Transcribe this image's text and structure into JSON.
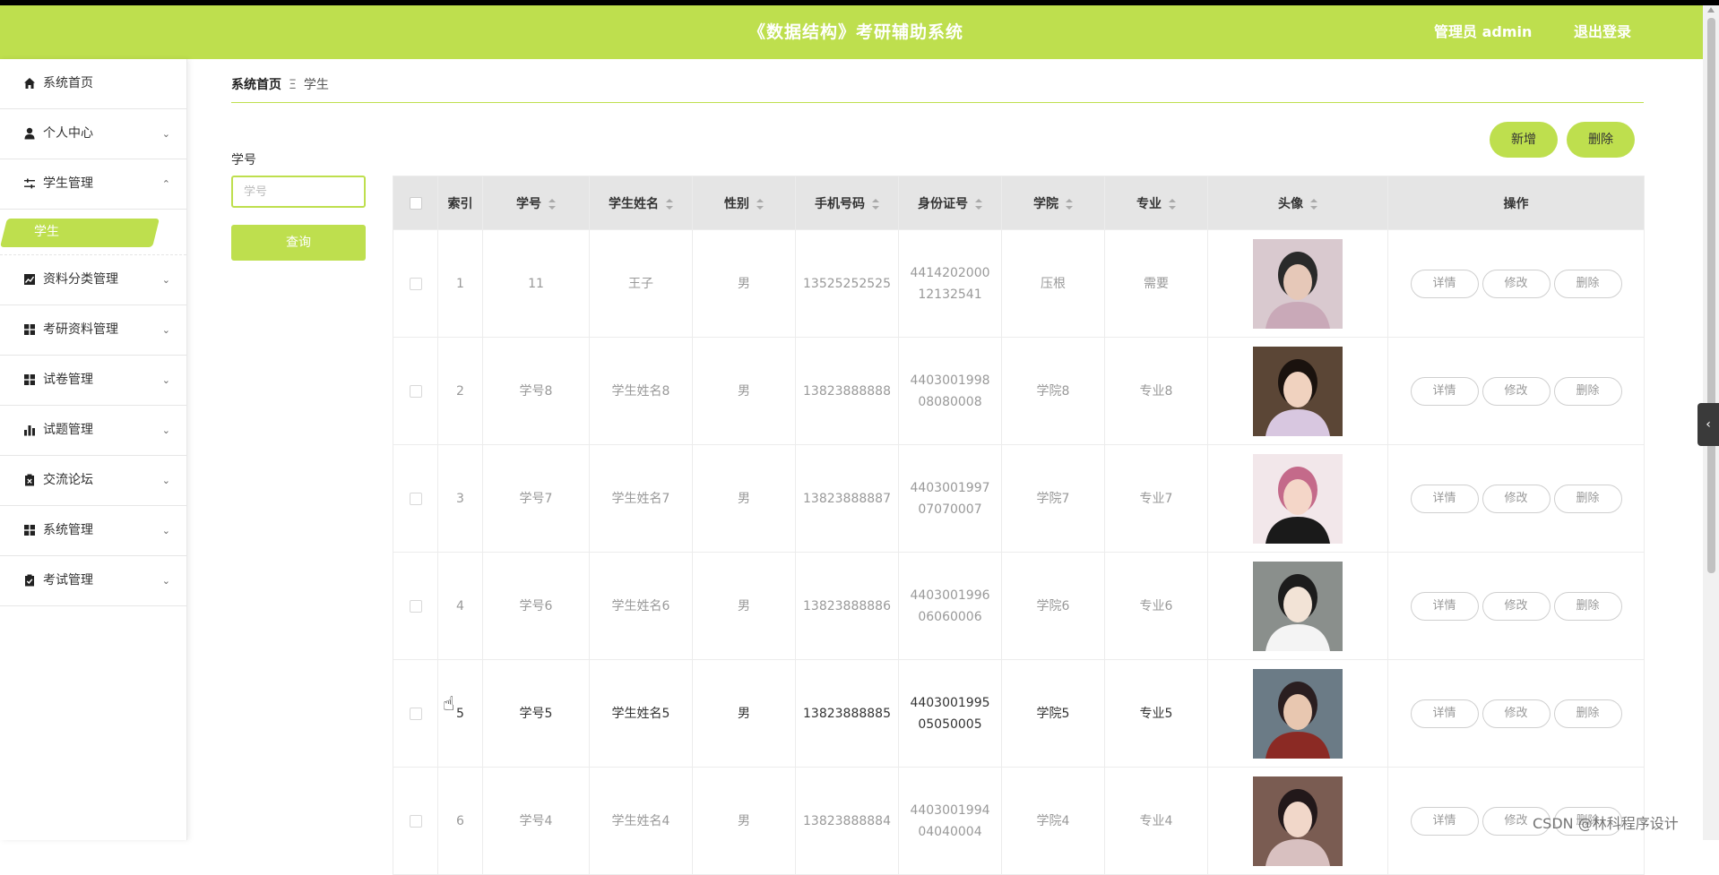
{
  "header": {
    "title": "《数据结构》考研辅助系统",
    "user": "管理员 admin",
    "logout": "退出登录"
  },
  "colors": {
    "accent": "#bedf4e"
  },
  "sidebar": {
    "items": [
      {
        "label": "系统首页",
        "icon": "home-icon",
        "arrow": ""
      },
      {
        "label": "个人中心",
        "icon": "user-icon",
        "arrow": "⌄"
      },
      {
        "label": "学生管理",
        "icon": "sliders-icon",
        "arrow": "⌃"
      },
      {
        "label": "资料分类管理",
        "icon": "line-chart-icon",
        "arrow": "⌄"
      },
      {
        "label": "考研资料管理",
        "icon": "grid-icon",
        "arrow": "⌄"
      },
      {
        "label": "试卷管理",
        "icon": "grid-icon",
        "arrow": "⌄"
      },
      {
        "label": "试题管理",
        "icon": "bar-chart-icon",
        "arrow": "⌄"
      },
      {
        "label": "交流论坛",
        "icon": "clipboard-x-icon",
        "arrow": "⌄"
      },
      {
        "label": "系统管理",
        "icon": "grid-icon",
        "arrow": "⌄"
      },
      {
        "label": "考试管理",
        "icon": "clipboard-check-icon",
        "arrow": "⌄"
      }
    ],
    "sub_active": "学生"
  },
  "breadcrumb": {
    "home": "系统首页",
    "sep": "Ξ",
    "current": "学生"
  },
  "filter": {
    "label": "学号",
    "placeholder": "学号",
    "query": "查询"
  },
  "actions": {
    "add": "新增",
    "delete": "删除"
  },
  "table": {
    "headers": [
      "索引",
      "学号",
      "学生姓名",
      "性别",
      "手机号码",
      "身份证号",
      "学院",
      "专业",
      "头像",
      "操作"
    ],
    "rows": [
      {
        "index": "1",
        "id": "11",
        "name": "王子",
        "gender": "男",
        "phone": "13525252525",
        "idcard": "441420200012132541",
        "college": "压根",
        "major": "需要",
        "avatar": "portrait-1"
      },
      {
        "index": "2",
        "id": "学号8",
        "name": "学生姓名8",
        "gender": "男",
        "phone": "13823888888",
        "idcard": "440300199808080008",
        "college": "学院8",
        "major": "专业8",
        "avatar": "portrait-2"
      },
      {
        "index": "3",
        "id": "学号7",
        "name": "学生姓名7",
        "gender": "男",
        "phone": "13823888887",
        "idcard": "440300199707070007",
        "college": "学院7",
        "major": "专业7",
        "avatar": "portrait-3"
      },
      {
        "index": "4",
        "id": "学号6",
        "name": "学生姓名6",
        "gender": "男",
        "phone": "13823888886",
        "idcard": "440300199606060006",
        "college": "学院6",
        "major": "专业6",
        "avatar": "portrait-4"
      },
      {
        "index": "5",
        "id": "学号5",
        "name": "学生姓名5",
        "gender": "男",
        "phone": "13823888885",
        "idcard": "440300199505050005",
        "college": "学院5",
        "major": "专业5",
        "avatar": "portrait-5"
      },
      {
        "index": "6",
        "id": "学号4",
        "name": "学生姓名4",
        "gender": "男",
        "phone": "13823888884",
        "idcard": "440300199404040004",
        "college": "学院4",
        "major": "专业4",
        "avatar": "portrait-6"
      }
    ],
    "row_actions": {
      "detail": "详情",
      "edit": "修改",
      "delete": "删除"
    }
  },
  "watermark": "CSDN @林科程序设计"
}
